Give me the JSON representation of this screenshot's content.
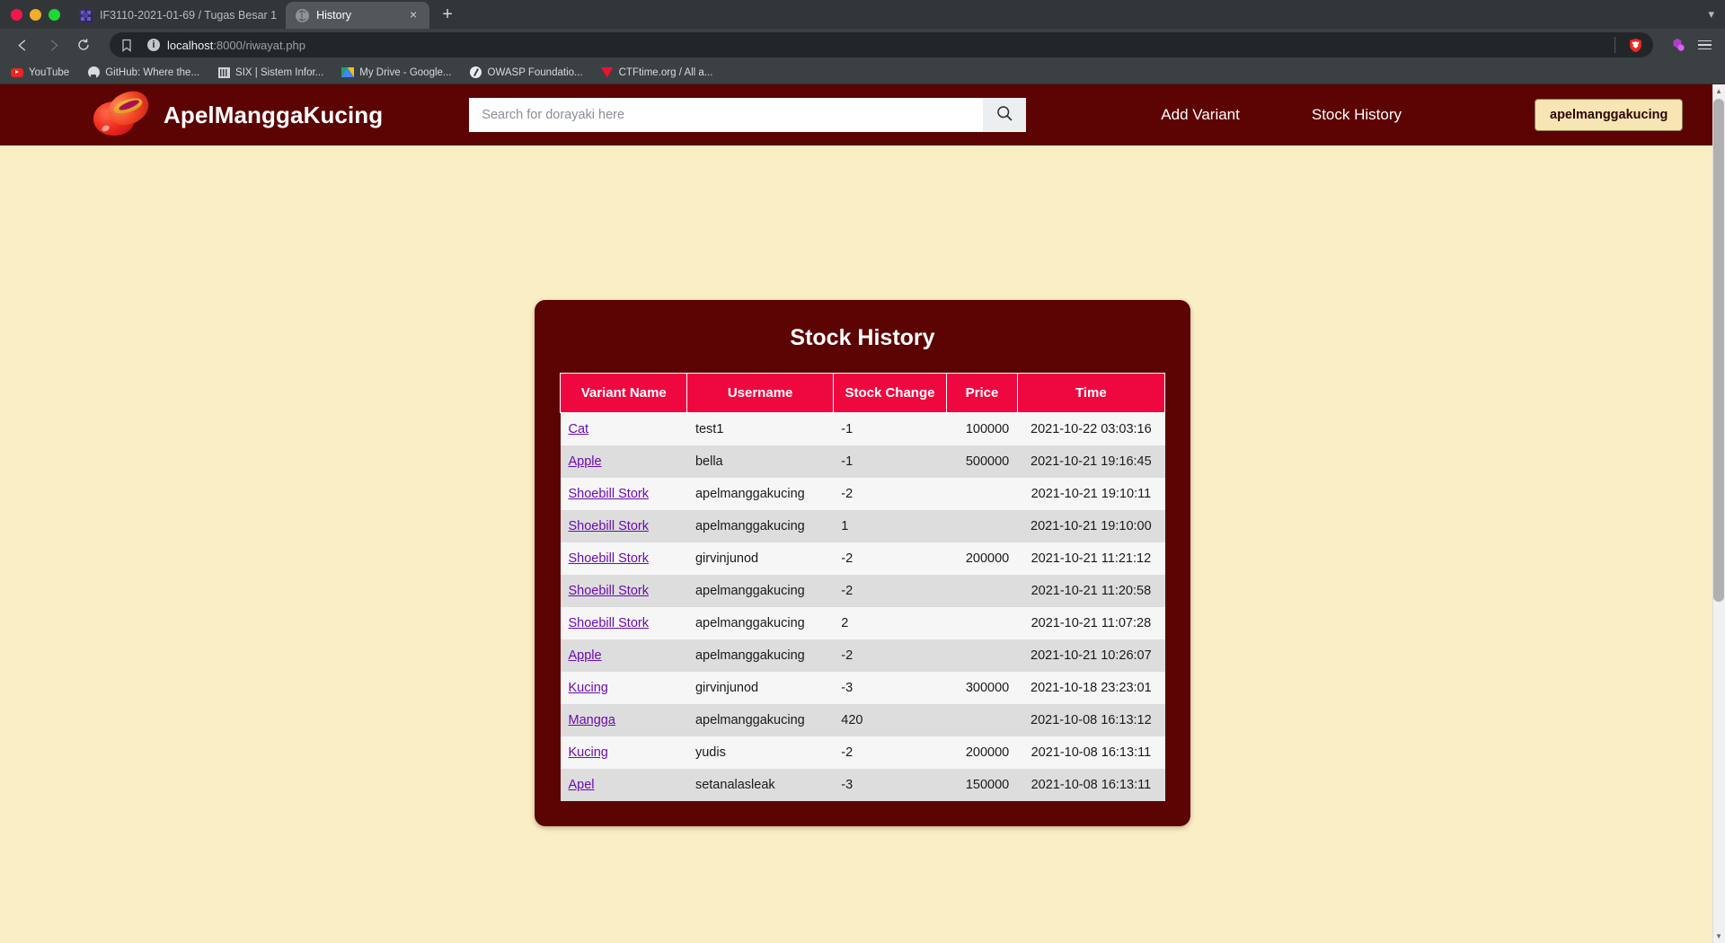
{
  "browser": {
    "window_controls": [
      "close",
      "minimize",
      "maximize"
    ],
    "tabs": [
      {
        "title": "IF3110-2021-01-69 / Tugas Besar 1",
        "favicon": "gitlab-icon",
        "active": false
      },
      {
        "title": "History",
        "favicon": "globe-icon",
        "active": true
      }
    ],
    "new_tab_label": "+",
    "tab_close_label": "×",
    "nav": {
      "back": "back-arrow",
      "forward": "forward-arrow",
      "reload": "reload-icon"
    },
    "url": {
      "host": "localhost",
      "path": ":8000/riwayat.php",
      "full": "localhost:8000/riwayat.php",
      "security_label": "i"
    },
    "bookmarks": [
      {
        "label": "YouTube",
        "icon": "youtube-icon"
      },
      {
        "label": "GitHub: Where the...",
        "icon": "github-icon"
      },
      {
        "label": "SIX | Sistem Infor...",
        "icon": "six-icon"
      },
      {
        "label": "My Drive - Google...",
        "icon": "google-drive-icon"
      },
      {
        "label": "OWASP Foundatio...",
        "icon": "owasp-icon"
      },
      {
        "label": "CTFtime.org / All a...",
        "icon": "ctftime-icon"
      }
    ]
  },
  "site": {
    "brand_name": "ApelManggaKucing",
    "search": {
      "placeholder": "Search for dorayaki here",
      "value": "",
      "button_icon": "search-icon"
    },
    "nav_links": [
      {
        "label": "Add Variant"
      },
      {
        "label": "Stock History"
      }
    ],
    "user_badge": "apelmanggakucing",
    "colors": {
      "header_bg": "#5c0303",
      "page_bg": "#faeec4",
      "table_header_bg": "#ef0840",
      "badge_bg": "#f7e5b3",
      "link": "#6a0dad"
    }
  },
  "card": {
    "title": "Stock History",
    "table": {
      "columns": [
        "Variant Name",
        "Username",
        "Stock Change",
        "Price",
        "Time"
      ],
      "rows": [
        {
          "variant": "Cat",
          "username": "test1",
          "change": "-1",
          "price": "100000",
          "time": "2021-10-22 03:03:16"
        },
        {
          "variant": "Apple",
          "username": "bella",
          "change": "-1",
          "price": "500000",
          "time": "2021-10-21 19:16:45"
        },
        {
          "variant": "Shoebill Stork",
          "username": "apelmanggakucing",
          "change": "-2",
          "price": "",
          "time": "2021-10-21 19:10:11"
        },
        {
          "variant": "Shoebill Stork",
          "username": "apelmanggakucing",
          "change": "1",
          "price": "",
          "time": "2021-10-21 19:10:00"
        },
        {
          "variant": "Shoebill Stork",
          "username": "girvinjunod",
          "change": "-2",
          "price": "200000",
          "time": "2021-10-21 11:21:12"
        },
        {
          "variant": "Shoebill Stork",
          "username": "apelmanggakucing",
          "change": "-2",
          "price": "",
          "time": "2021-10-21 11:20:58"
        },
        {
          "variant": "Shoebill Stork",
          "username": "apelmanggakucing",
          "change": "2",
          "price": "",
          "time": "2021-10-21 11:07:28"
        },
        {
          "variant": "Apple",
          "username": "apelmanggakucing",
          "change": "-2",
          "price": "",
          "time": "2021-10-21 10:26:07"
        },
        {
          "variant": "Kucing",
          "username": "girvinjunod",
          "change": "-3",
          "price": "300000",
          "time": "2021-10-18 23:23:01"
        },
        {
          "variant": "Mangga",
          "username": "apelmanggakucing",
          "change": "420",
          "price": "",
          "time": "2021-10-08 16:13:12"
        },
        {
          "variant": "Kucing",
          "username": "yudis",
          "change": "-2",
          "price": "200000",
          "time": "2021-10-08 16:13:11"
        },
        {
          "variant": "Apel",
          "username": "setanalasleak",
          "change": "-3",
          "price": "150000",
          "time": "2021-10-08 16:13:11"
        }
      ]
    }
  }
}
